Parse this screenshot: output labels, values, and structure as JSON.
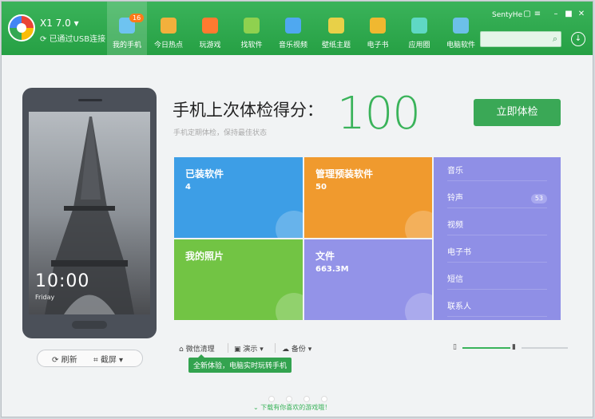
{
  "app": {
    "version": "X1 7.0",
    "conn_status": "已通过USB连接"
  },
  "nav": [
    {
      "label": "我的手机",
      "icon": "phone-icon",
      "color": "#6ec3f0"
    },
    {
      "label": "今日热点",
      "icon": "star-icon",
      "color": "#f2b03c"
    },
    {
      "label": "玩游戏",
      "icon": "gamepad-icon",
      "color": "#ff7a30"
    },
    {
      "label": "找软件",
      "icon": "android-icon",
      "color": "#8fd14f"
    },
    {
      "label": "音乐视频",
      "icon": "play-icon",
      "color": "#4fa8f0"
    },
    {
      "label": "壁纸主题",
      "icon": "wallpaper-icon",
      "color": "#e8d048"
    },
    {
      "label": "电子书",
      "icon": "book-icon",
      "color": "#f0b830"
    },
    {
      "label": "应用圈",
      "icon": "circle-icon",
      "color": "#5fd8c4"
    },
    {
      "label": "电脑软件",
      "icon": "grid-icon",
      "color": "#6cc0e8"
    }
  ],
  "nav_badge": "16",
  "window": {
    "user": "SentyHe"
  },
  "phone": {
    "clock": "10:00",
    "date": "Friday"
  },
  "phone_tools": {
    "refresh": "刷新",
    "screenshot": "截屏"
  },
  "score": {
    "title": "手机上次体检得分：",
    "value": "100",
    "subtitle": "手机定期体检，保持最佳状态",
    "check_button": "立即体检"
  },
  "tiles": {
    "installed": {
      "title": "已装软件",
      "value": "4"
    },
    "preinstalled": {
      "title": "管理预装软件",
      "value": "50"
    },
    "photos": {
      "title": "我的照片",
      "value": ""
    },
    "files": {
      "title": "文件",
      "value": "663.3M"
    }
  },
  "panel": [
    {
      "label": "音乐",
      "badge": ""
    },
    {
      "label": "铃声",
      "badge": "53"
    },
    {
      "label": "视频",
      "badge": ""
    },
    {
      "label": "电子书",
      "badge": ""
    },
    {
      "label": "短信",
      "badge": ""
    },
    {
      "label": "联系人",
      "badge": ""
    }
  ],
  "bottom": {
    "wechat": "微信清理",
    "demo": "演示",
    "backup": "备份",
    "tooltip": "全新体验，电脑实时玩转手机"
  },
  "footer_link": "下载有你喜欢的游戏哦！",
  "colors": {
    "header": "#2aa84a",
    "installed": "#3d9ee6",
    "preinstalled": "#f09a2e",
    "photos": "#72c444",
    "files": "#9393e8",
    "panel": "#8f8fe6",
    "score": "#3ab35a"
  }
}
